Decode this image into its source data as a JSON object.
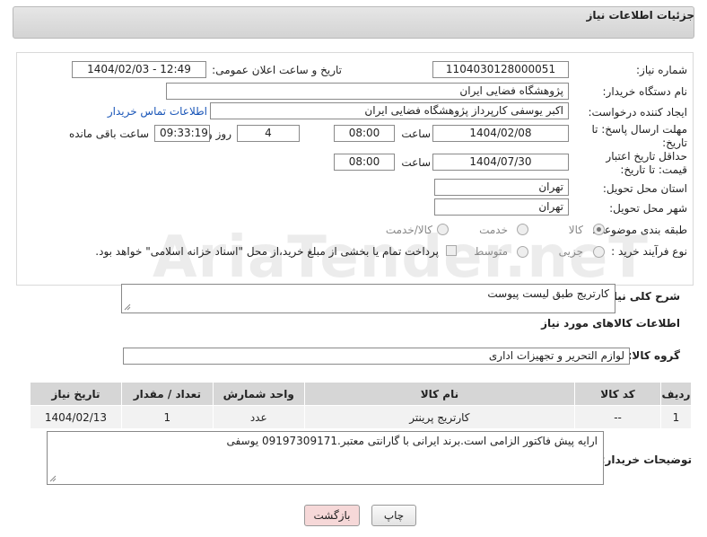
{
  "header": {
    "title": "جزئیات اطلاعات نیاز"
  },
  "fields": {
    "need_number_label": "شماره نیاز:",
    "need_number": "1104030128000051",
    "announce_label": "تاریخ و ساعت اعلان عمومی:",
    "announce_value": "1404/02/03 - 12:49",
    "buyer_org_label": "نام دستگاه خریدار:",
    "buyer_org": "پژوهشگاه فضایی ایران",
    "creator_label": "ایجاد کننده درخواست:",
    "creator": "اکبر یوسفی کارپرداز پژوهشگاه فضایی ایران",
    "contact_link": "اطلاعات تماس خریدار",
    "reply_deadline_label": "مهلت ارسال پاسخ: تا تاریخ:",
    "reply_date": "1404/02/08",
    "time_label": "ساعت",
    "reply_time": "08:00",
    "days_value": "4",
    "days_label": "روز و",
    "remaining_time": "09:33:19",
    "remaining_label": "ساعت باقی مانده",
    "price_validity_label": "حداقل تاریخ اعتبار قیمت: تا تاریخ:",
    "price_date": "1404/07/30",
    "price_time": "08:00",
    "province_label": "استان محل تحویل:",
    "province": "تهران",
    "city_label": "شهر محل تحویل:",
    "city": "تهران",
    "category_label": "طبقه بندی موضوعی:",
    "category_options": [
      "کالا",
      "خدمت",
      "کالا/خدمت"
    ],
    "category_selected": "کالا",
    "process_label": "نوع فرآیند خرید :",
    "process_options": [
      "جزیی",
      "متوسط"
    ],
    "payment_note": "پرداخت تمام یا بخشی از مبلغ خرید،از محل \"اسناد خزانه اسلامی\" خواهد بود."
  },
  "summary": {
    "label": "شرح کلی نیاز:",
    "value": "کارتریج طبق لیست پیوست"
  },
  "goods": {
    "section_title": "اطلاعات کالاهای مورد نیاز",
    "group_label": "گروه کالا:",
    "group_value": "لوازم التحریر و تجهیزات اداری",
    "columns": [
      "ردیف",
      "کد کالا",
      "نام کالا",
      "واحد شمارش",
      "تعداد / مقدار",
      "تاریخ نیاز"
    ],
    "rows": [
      {
        "index": "1",
        "code": "--",
        "name": "کارتریج پرینتر",
        "unit": "عدد",
        "qty": "1",
        "date": "1404/02/13"
      }
    ]
  },
  "buyer_notes": {
    "label": "توضیحات خریدار:",
    "value": "ارایه پیش فاکتور الزامی است.برند ایرانی با گارانتی معتبر.09197309171 یوسفی"
  },
  "buttons": {
    "print": "چاپ",
    "back": "بازگشت"
  },
  "watermark": "AriaTender.neT",
  "colors": {
    "link": "#1a56b8",
    "back_button": "#f6d8d8",
    "header": "#dcdcdc"
  }
}
